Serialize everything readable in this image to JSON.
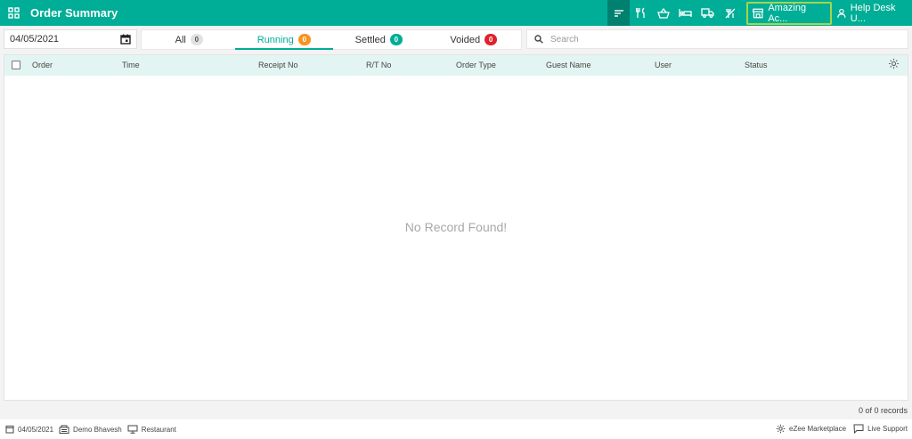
{
  "app": {
    "title": "Order Summary"
  },
  "topbar": {
    "icons": [
      "sort-icon",
      "restaurant-icon",
      "basket-icon",
      "bed-icon",
      "delivery-truck-icon",
      "no-service-icon"
    ],
    "outlet_label": "Amazing Ac...",
    "user_label": "Help Desk U..."
  },
  "filter": {
    "date": "04/05/2021",
    "search_placeholder": "Search",
    "search_value": ""
  },
  "tabs": [
    {
      "label": "All",
      "count": "0",
      "color": "grey"
    },
    {
      "label": "Running",
      "count": "0",
      "color": "orange",
      "active": true
    },
    {
      "label": "Settled",
      "count": "0",
      "color": "teal"
    },
    {
      "label": "Voided",
      "count": "0",
      "color": "red"
    }
  ],
  "table": {
    "columns": [
      "Order",
      "Time",
      "Receipt No",
      "R/T No",
      "Order Type",
      "Guest Name",
      "User",
      "Status"
    ],
    "rows": [],
    "empty_text": "No Record Found!",
    "record_count": "0 of 0 records"
  },
  "footer": {
    "date": "04/05/2021",
    "property": "Demo Bhavesh",
    "outlet": "Restaurant",
    "marketplace": "eZee Marketplace",
    "support": "Live Support"
  },
  "colors": {
    "brand": "#00ad96",
    "active_tab_bg": "#00806f",
    "outlet_border": "#a4d64b",
    "header_bg": "#e3f5f2"
  }
}
